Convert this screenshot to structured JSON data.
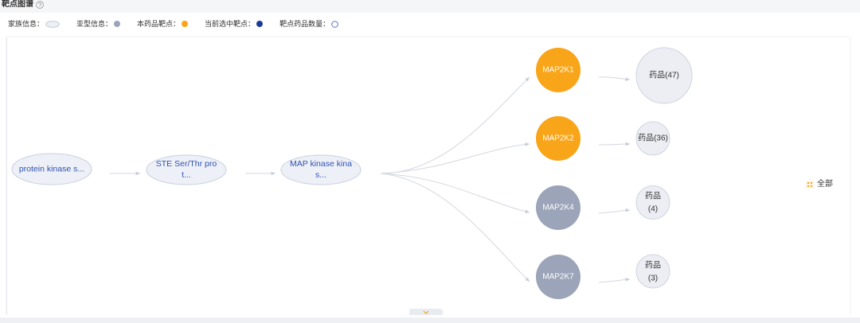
{
  "header": {
    "title": "靶点图谱",
    "help_icon": "question-circle-icon"
  },
  "legend": [
    {
      "label": "家族信息：",
      "icon": "ellipse-outline"
    },
    {
      "label": "亚型信息：",
      "icon": "filled-dot",
      "color": "#9ba4b8"
    },
    {
      "label": "本药品靶点：",
      "icon": "filled-dot",
      "color": "#f9a51a"
    },
    {
      "label": "当前选中靶点：",
      "icon": "filled-dot",
      "color": "#1c3b98"
    },
    {
      "label": "靶点药品数量：",
      "icon": "hollow-circle"
    }
  ],
  "family_chain": [
    {
      "lines": [
        "protein kinase s..."
      ]
    },
    {
      "lines": [
        "STE Ser/Thr pro",
        "t..."
      ]
    },
    {
      "lines": [
        "MAP kinase kina",
        "s..."
      ]
    }
  ],
  "targets": [
    {
      "name": "MAP2K1",
      "color": "#f9a51a",
      "drugs": {
        "lines": [
          "药品(47)"
        ]
      }
    },
    {
      "name": "MAP2K2",
      "color": "#f9a51a",
      "drugs": {
        "lines": [
          "药品(36)"
        ]
      }
    },
    {
      "name": "MAP2K4",
      "color": "#9ba4b8",
      "drugs": {
        "lines": [
          "药品",
          "(4)"
        ]
      }
    },
    {
      "name": "MAP2K7",
      "color": "#9ba4b8",
      "drugs": {
        "lines": [
          "药品",
          "(3)"
        ]
      }
    }
  ],
  "filter": {
    "label": "全部",
    "icon": "grid-icon"
  },
  "collapse": {
    "icon": "chevron-down-icon"
  }
}
